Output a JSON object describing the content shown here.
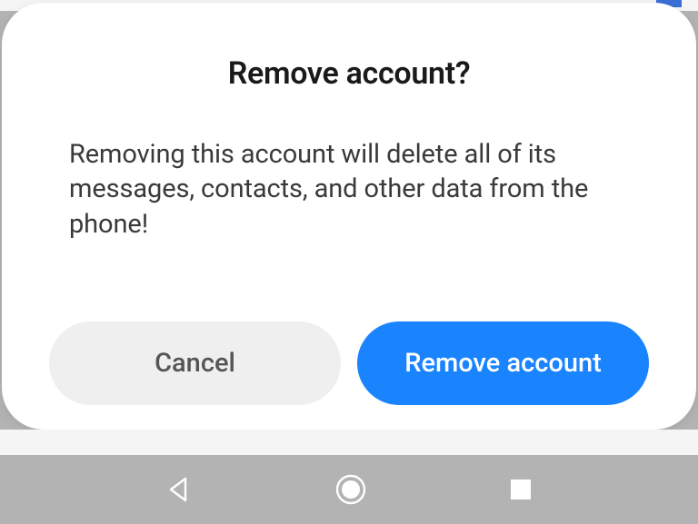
{
  "dialog": {
    "title": "Remove account?",
    "body": "Removing this account will delete all of its messages, contacts, and other data from the phone!",
    "cancel_label": "Cancel",
    "confirm_label": "Remove account"
  },
  "colors": {
    "confirm_bg": "#1a84ff",
    "cancel_bg": "#efefef"
  }
}
